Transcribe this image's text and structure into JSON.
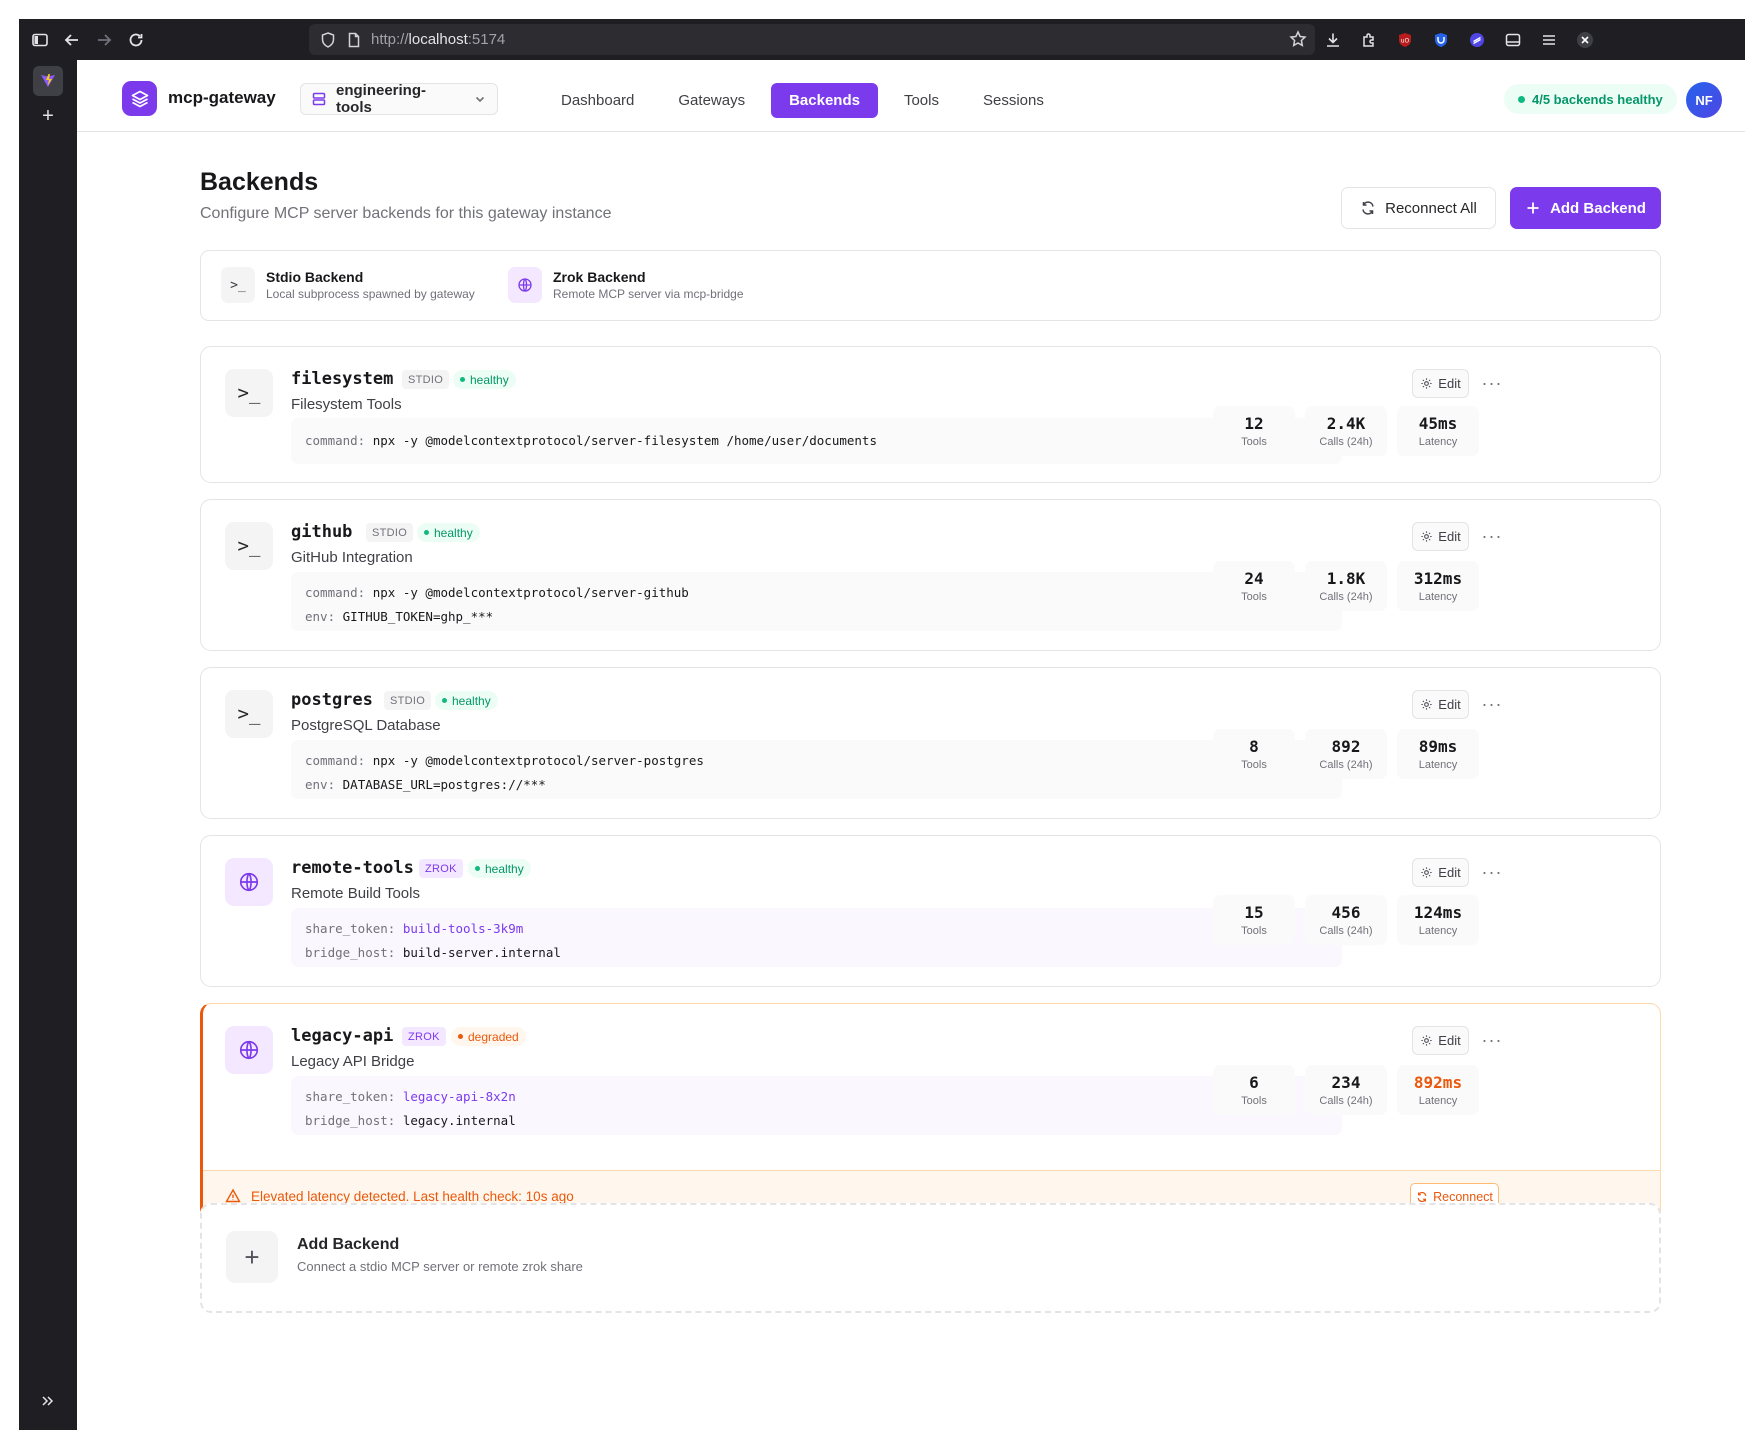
{
  "browser": {
    "url_proto": "http://",
    "url_host": "localhost",
    "url_port": ":5174"
  },
  "header": {
    "app_name": "mcp-gateway",
    "workspace": "engineering-tools",
    "nav": [
      {
        "label": "Dashboard",
        "active": false
      },
      {
        "label": "Gateways",
        "active": false
      },
      {
        "label": "Backends",
        "active": true
      },
      {
        "label": "Tools",
        "active": false
      },
      {
        "label": "Sessions",
        "active": false
      }
    ],
    "health": "4/5 backends healthy",
    "avatar_initials": "NF"
  },
  "page": {
    "title": "Backends",
    "subtitle": "Configure MCP server backends for this gateway instance",
    "reconnect_all": "Reconnect All",
    "add_backend": "Add Backend"
  },
  "legend": {
    "stdio": {
      "icon": ">_",
      "title": "Stdio Backend",
      "desc": "Local subprocess spawned by gateway"
    },
    "zrok": {
      "icon": "globe-icon",
      "title": "Zrok Backend",
      "desc": "Remote MCP server via mcp-bridge"
    }
  },
  "backends": [
    {
      "name": "filesystem",
      "type": "STDIO",
      "status": "healthy",
      "desc": "Filesystem Tools",
      "config": [
        {
          "key": "command:",
          "value": "npx -y @modelcontextprotocol/server-filesystem /home/user/documents"
        }
      ],
      "stats": {
        "tools": "12",
        "calls": "2.4K",
        "latency": "45ms"
      }
    },
    {
      "name": "github",
      "type": "STDIO",
      "status": "healthy",
      "desc": "GitHub Integration",
      "config": [
        {
          "key": "command:",
          "value": "npx -y @modelcontextprotocol/server-github"
        },
        {
          "key": "env:",
          "value": "GITHUB_TOKEN=ghp_***"
        }
      ],
      "stats": {
        "tools": "24",
        "calls": "1.8K",
        "latency": "312ms"
      }
    },
    {
      "name": "postgres",
      "type": "STDIO",
      "status": "healthy",
      "desc": "PostgreSQL Database",
      "config": [
        {
          "key": "command:",
          "value": "npx -y @modelcontextprotocol/server-postgres"
        },
        {
          "key": "env:",
          "value": "DATABASE_URL=postgres://***"
        }
      ],
      "stats": {
        "tools": "8",
        "calls": "892",
        "latency": "89ms"
      }
    },
    {
      "name": "remote-tools",
      "type": "ZROK",
      "status": "healthy",
      "desc": "Remote Build Tools",
      "config": [
        {
          "key": "share_token:",
          "value": "build-tools-3k9m"
        },
        {
          "key": "bridge_host:",
          "value": "build-server.internal"
        }
      ],
      "stats": {
        "tools": "15",
        "calls": "456",
        "latency": "124ms"
      }
    },
    {
      "name": "legacy-api",
      "type": "ZROK",
      "status": "degraded",
      "desc": "Legacy API Bridge",
      "config": [
        {
          "key": "share_token:",
          "value": "legacy-api-8x2n"
        },
        {
          "key": "bridge_host:",
          "value": "legacy.internal"
        }
      ],
      "stats": {
        "tools": "6",
        "calls": "234",
        "latency": "892ms"
      },
      "alert": "Elevated latency detected. Last health check: 10s ago",
      "alert_action": "Reconnect"
    }
  ],
  "labels": {
    "edit": "Edit",
    "more": "···",
    "tools": "Tools",
    "calls": "Calls (24h)",
    "latency": "Latency"
  },
  "add_card": {
    "title": "Add Backend",
    "desc": "Connect a stdio MCP server or remote zrok share"
  },
  "colors": {
    "accent": "#7c3aed",
    "healthy": "#059669",
    "degraded": "#ea580c"
  }
}
